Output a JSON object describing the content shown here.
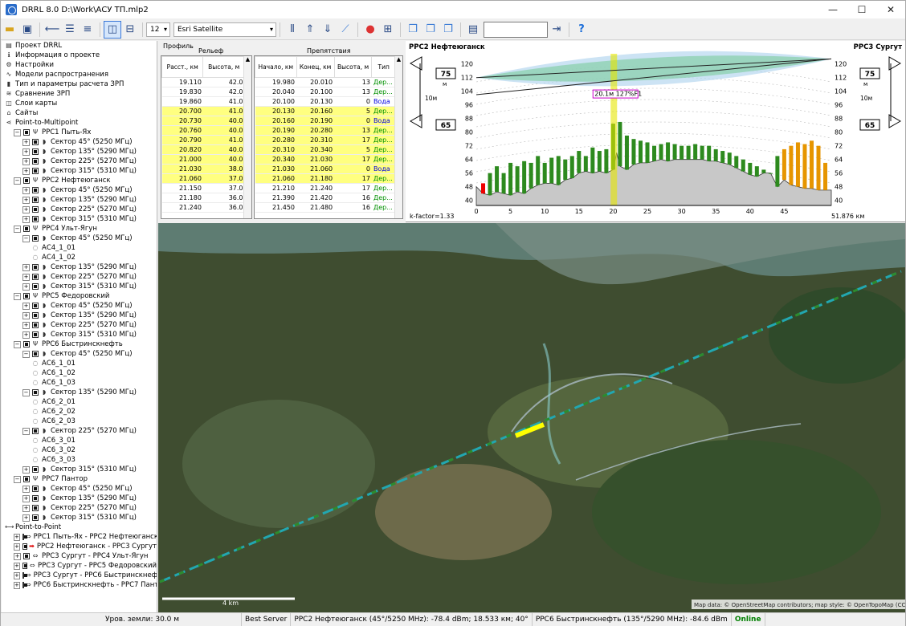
{
  "window": {
    "title": "DRRL 8.0 D:\\Work\\АСУ ТП.mlp2",
    "minimize": "—",
    "maximize": "☐",
    "close": "✕"
  },
  "toolbar": {
    "zoom_value": "12",
    "map_layer": "Esri Satellite",
    "help": "?"
  },
  "tree": [
    {
      "level": 0,
      "text": "Проект DRRL",
      "icon": "project-icon"
    },
    {
      "level": 0,
      "text": "Информация о проекте",
      "icon": "info-icon"
    },
    {
      "level": 0,
      "text": "Настройки",
      "icon": "gear-icon"
    },
    {
      "level": 0,
      "text": "Модели распространения",
      "icon": "wave-icon"
    },
    {
      "level": 0,
      "text": "Тип и параметры расчета ЗРП",
      "icon": "bars-icon"
    },
    {
      "level": 0,
      "text": "Сравнение ЗРП",
      "icon": "compare-icon"
    },
    {
      "level": 0,
      "text": "Слои карты",
      "icon": "layers-icon"
    },
    {
      "level": 0,
      "text": "Сайты",
      "icon": "sites-icon"
    },
    {
      "level": 0,
      "text": "Point-to-Multipoint",
      "icon": "p2mp-icon"
    },
    {
      "level": 1,
      "text": "РРС1 Пыть-Ях",
      "expander": "−",
      "checkbox": true,
      "icon": "tower-icon"
    },
    {
      "level": 2,
      "text": "Сектор 45° (5250 МГц)",
      "expander": "+",
      "checkbox": true,
      "icon": "sector-icon"
    },
    {
      "level": 2,
      "text": "Сектор 135° (5290 МГц)",
      "expander": "+",
      "checkbox": true,
      "icon": "sector-icon"
    },
    {
      "level": 2,
      "text": "Сектор 225° (5270 МГц)",
      "expander": "+",
      "checkbox": true,
      "icon": "sector-icon"
    },
    {
      "level": 2,
      "text": "Сектор 315° (5310 МГц)",
      "expander": "+",
      "checkbox": true,
      "icon": "sector-icon"
    },
    {
      "level": 1,
      "text": "РРС2 Нефтеюганск",
      "expander": "−",
      "checkbox": true,
      "icon": "tower-icon"
    },
    {
      "level": 2,
      "text": "Сектор 45° (5250 МГц)",
      "expander": "+",
      "checkbox": true,
      "icon": "sector-icon"
    },
    {
      "level": 2,
      "text": "Сектор 135° (5290 МГц)",
      "expander": "+",
      "checkbox": true,
      "icon": "sector-icon"
    },
    {
      "level": 2,
      "text": "Сектор 225° (5270 МГц)",
      "expander": "+",
      "checkbox": true,
      "icon": "sector-icon"
    },
    {
      "level": 2,
      "text": "Сектор 315° (5310 МГц)",
      "expander": "+",
      "checkbox": true,
      "icon": "sector-icon"
    },
    {
      "level": 1,
      "text": "РРС4 Ульт-Ягун",
      "expander": "−",
      "checkbox": true,
      "icon": "tower-icon"
    },
    {
      "level": 2,
      "text": "Сектор 45° (5250 МГц)",
      "expander": "−",
      "checkbox": true,
      "icon": "sector-icon"
    },
    {
      "level": 3,
      "text": "АС4_1_01",
      "icon": "client-icon"
    },
    {
      "level": 3,
      "text": "АС4_1_02",
      "icon": "client-icon"
    },
    {
      "level": 2,
      "text": "Сектор 135° (5290 МГц)",
      "expander": "+",
      "checkbox": true,
      "icon": "sector-icon"
    },
    {
      "level": 2,
      "text": "Сектор 225° (5270 МГц)",
      "expander": "+",
      "checkbox": true,
      "icon": "sector-icon"
    },
    {
      "level": 2,
      "text": "Сектор 315° (5310 МГц)",
      "expander": "+",
      "checkbox": true,
      "icon": "sector-icon"
    },
    {
      "level": 1,
      "text": "РРС5 Федоровский",
      "expander": "−",
      "checkbox": true,
      "icon": "tower-icon"
    },
    {
      "level": 2,
      "text": "Сектор 45° (5250 МГц)",
      "expander": "+",
      "checkbox": true,
      "icon": "sector-icon"
    },
    {
      "level": 2,
      "text": "Сектор 135° (5290 МГц)",
      "expander": "+",
      "checkbox": true,
      "icon": "sector-icon"
    },
    {
      "level": 2,
      "text": "Сектор 225° (5270 МГц)",
      "expander": "+",
      "checkbox": true,
      "icon": "sector-icon"
    },
    {
      "level": 2,
      "text": "Сектор 315° (5310 МГц)",
      "expander": "+",
      "checkbox": true,
      "icon": "sector-icon"
    },
    {
      "level": 1,
      "text": "РРС6 Быстринскнефть",
      "expander": "−",
      "checkbox": true,
      "icon": "tower-icon"
    },
    {
      "level": 2,
      "text": "Сектор 45° (5250 МГц)",
      "expander": "−",
      "checkbox": true,
      "icon": "sector-icon"
    },
    {
      "level": 3,
      "text": "АС6_1_01",
      "icon": "client-icon"
    },
    {
      "level": 3,
      "text": "АС6_1_02",
      "icon": "client-icon"
    },
    {
      "level": 3,
      "text": "АС6_1_03",
      "icon": "client-icon"
    },
    {
      "level": 2,
      "text": "Сектор 135° (5290 МГц)",
      "expander": "−",
      "checkbox": true,
      "icon": "sector-icon"
    },
    {
      "level": 3,
      "text": "АС6_2_01",
      "icon": "client-icon"
    },
    {
      "level": 3,
      "text": "АС6_2_02",
      "icon": "client-icon"
    },
    {
      "level": 3,
      "text": "АС6_2_03",
      "icon": "client-icon"
    },
    {
      "level": 2,
      "text": "Сектор 225° (5270 МГц)",
      "expander": "−",
      "checkbox": true,
      "icon": "sector-icon"
    },
    {
      "level": 3,
      "text": "АС6_3_01",
      "icon": "client-icon"
    },
    {
      "level": 3,
      "text": "АС6_3_02",
      "icon": "client-icon"
    },
    {
      "level": 3,
      "text": "АС6_3_03",
      "icon": "client-icon"
    },
    {
      "level": 2,
      "text": "Сектор 315° (5310 МГц)",
      "expander": "+",
      "checkbox": true,
      "icon": "sector-icon"
    },
    {
      "level": 1,
      "text": "РРС7 Пантор",
      "expander": "−",
      "checkbox": true,
      "icon": "tower-icon"
    },
    {
      "level": 2,
      "text": "Сектор 45° (5250 МГц)",
      "expander": "+",
      "checkbox": true,
      "icon": "sector-icon"
    },
    {
      "level": 2,
      "text": "Сектор 135° (5290 МГц)",
      "expander": "+",
      "checkbox": true,
      "icon": "sector-icon"
    },
    {
      "level": 2,
      "text": "Сектор 225° (5270 МГц)",
      "expander": "+",
      "checkbox": true,
      "icon": "sector-icon"
    },
    {
      "level": 2,
      "text": "Сектор 315° (5310 МГц)",
      "expander": "+",
      "checkbox": true,
      "icon": "sector-icon"
    },
    {
      "level": 0,
      "text": "Point-to-Point",
      "icon": "p2p-icon"
    },
    {
      "level": 1,
      "text": "РРС1 Пыть-Ях - РРС2 Нефтеюганск",
      "expander": "+",
      "checkbox": true,
      "icon": "link-icon"
    },
    {
      "level": 1,
      "text": "РРС2 Нефтеюганск - РРС3 Сургут",
      "expander": "+",
      "checkbox": true,
      "icon": "link-active-icon",
      "selected": true
    },
    {
      "level": 1,
      "text": "РРС3 Сургут - РРС4 Ульт-Ягун",
      "expander": "+",
      "checkbox": true,
      "icon": "link-icon"
    },
    {
      "level": 1,
      "text": "РРС3 Сургут - РРС5 Федоровский",
      "expander": "+",
      "checkbox": true,
      "icon": "link-icon"
    },
    {
      "level": 1,
      "text": "РРС3 Сургут - РРС6 Быстринскнефть",
      "expander": "+",
      "checkbox": true,
      "icon": "link-icon"
    },
    {
      "level": 1,
      "text": "РРС6 Быстринскнефть - РРС7 Пантор",
      "expander": "+",
      "checkbox": true,
      "icon": "link-icon"
    }
  ],
  "profile": {
    "tab_label": "Профиль",
    "relief": {
      "title": "Рельеф",
      "col1": "Расст., км",
      "col2": "Высота, м",
      "rows": [
        [
          "19.110",
          "42.0",
          0
        ],
        [
          "19.830",
          "42.0",
          0
        ],
        [
          "19.860",
          "41.0",
          0
        ],
        [
          "20.700",
          "41.0",
          1
        ],
        [
          "20.730",
          "40.0",
          1
        ],
        [
          "20.760",
          "40.0",
          1
        ],
        [
          "20.790",
          "41.0",
          1
        ],
        [
          "20.820",
          "40.0",
          1
        ],
        [
          "21.000",
          "40.0",
          1
        ],
        [
          "21.030",
          "38.0",
          1
        ],
        [
          "21.060",
          "37.0",
          1
        ],
        [
          "21.150",
          "37.0",
          0
        ],
        [
          "21.180",
          "36.0",
          0
        ],
        [
          "21.240",
          "36.0",
          0
        ]
      ]
    },
    "obstacles": {
      "title": "Препятствия",
      "col1": "Начало, км",
      "col2": "Конец, км",
      "col3": "Высота, м",
      "col4": "Тип",
      "rows": [
        [
          "19.980",
          "20.010",
          "13",
          "Дер...",
          0,
          "g"
        ],
        [
          "20.040",
          "20.100",
          "13",
          "Дер...",
          0,
          "g"
        ],
        [
          "20.100",
          "20.130",
          "0",
          "Вода",
          0,
          "b"
        ],
        [
          "20.130",
          "20.160",
          "5",
          "Дер...",
          1,
          "g"
        ],
        [
          "20.160",
          "20.190",
          "0",
          "Вода",
          1,
          "b"
        ],
        [
          "20.190",
          "20.280",
          "13",
          "Дер...",
          1,
          "g"
        ],
        [
          "20.280",
          "20.310",
          "17",
          "Дер...",
          1,
          "g"
        ],
        [
          "20.310",
          "20.340",
          "5",
          "Дер...",
          1,
          "g"
        ],
        [
          "20.340",
          "21.030",
          "17",
          "Дер...",
          1,
          "g"
        ],
        [
          "21.030",
          "21.060",
          "0",
          "Вода",
          1,
          "b"
        ],
        [
          "21.060",
          "21.180",
          "17",
          "Дер...",
          1,
          "g"
        ],
        [
          "21.210",
          "21.240",
          "17",
          "Дер...",
          0,
          "g"
        ],
        [
          "21.390",
          "21.420",
          "16",
          "Дер...",
          0,
          "g"
        ],
        [
          "21.450",
          "21.480",
          "16",
          "Дер...",
          0,
          "g"
        ]
      ]
    }
  },
  "chart": {
    "left_station": "РРС2 Нефтеюганск",
    "right_station": "РРС3 Сургут",
    "left_ant_top": "75",
    "left_ant_bottom": "65",
    "right_ant_top": "75",
    "right_ant_bottom": "65",
    "unit_m": "м",
    "spacing_left": "10м",
    "spacing_right": "10м",
    "kfactor": "k-factor=1.33",
    "marker_label": "20.1м 127%F1",
    "distance_label": "51.876 км"
  },
  "chart_data": {
    "type": "area",
    "title": "",
    "xlabel": "",
    "ylabel": "",
    "xlim": [
      0,
      51.876
    ],
    "ylim": [
      37,
      126
    ],
    "x_ticks": [
      0,
      5,
      10,
      15,
      20,
      25,
      30,
      35,
      40,
      45
    ],
    "y_ticks": [
      40,
      48,
      56,
      64,
      72,
      80,
      88,
      96,
      104,
      112,
      120
    ],
    "terrain": {
      "x": [
        0,
        1,
        2,
        3,
        4,
        5,
        6,
        7,
        8,
        9,
        10,
        11,
        12,
        13,
        14,
        15,
        16,
        17,
        18,
        19,
        20,
        20.5,
        21,
        21.5,
        22,
        23,
        24,
        25,
        26,
        27,
        28,
        29,
        30,
        31,
        32,
        33,
        34,
        35,
        36,
        37,
        38,
        39,
        40,
        41,
        42,
        43,
        44,
        45,
        46,
        47,
        48,
        49,
        50,
        51,
        51.876
      ],
      "y": [
        48,
        44,
        43,
        45,
        44,
        43,
        45,
        44,
        47,
        49,
        50,
        50,
        49,
        52,
        53,
        56,
        57,
        56,
        57,
        56,
        58,
        68,
        60,
        59,
        58,
        61,
        62,
        62,
        63,
        64,
        63,
        64,
        64,
        64,
        64,
        64,
        63,
        63,
        62,
        61,
        59,
        57,
        55,
        54,
        56,
        56,
        48,
        52,
        49,
        48,
        47,
        47,
        46,
        46,
        46
      ]
    },
    "trees": {
      "x": [
        1,
        2,
        3,
        4,
        5,
        6,
        7,
        8,
        9,
        10,
        11,
        12,
        13,
        14,
        15,
        16,
        17,
        18,
        19,
        20,
        21,
        22,
        23,
        24,
        25,
        26,
        27,
        28,
        29,
        30,
        31,
        32,
        33,
        34,
        35,
        36,
        37,
        38,
        39,
        40,
        41,
        42,
        43,
        44,
        45,
        46,
        47,
        48,
        49,
        50,
        51
      ],
      "y": [
        50,
        56,
        60,
        56,
        62,
        60,
        63,
        62,
        66,
        62,
        65,
        66,
        64,
        66,
        69,
        66,
        71,
        69,
        70,
        85,
        86,
        78,
        76,
        75,
        74,
        72,
        73,
        74,
        73,
        72,
        72,
        73,
        72,
        72,
        70,
        69,
        68,
        66,
        64,
        62,
        60,
        58,
        56,
        66,
        70,
        72,
        74,
        73,
        75,
        72,
        62
      ]
    },
    "lines": [
      {
        "name": "",
        "x": [
          0,
          51.876
        ],
        "y": [
          112,
          123
        ]
      },
      {
        "name": "",
        "x": [
          0,
          51.876
        ],
        "y": [
          102,
          123
        ]
      }
    ],
    "marker_x": 20.1
  },
  "map": {
    "scale_label": "4 km",
    "attribution": "Map data: © OpenStreetMap contributors; map style: © OpenTopoMap (CC-BY-SA)"
  },
  "status": {
    "ground": "Уров. земли: 30.0 м",
    "server": "Best Server",
    "s1": "РРС2 Нефтеюганск (45°/5250 MHz): -78.4 dBm; 18.533 км; 40°",
    "s2": "РРС6 Быстринскнефть (135°/5290 MHz): -84.6 dBm",
    "online": "Online"
  }
}
